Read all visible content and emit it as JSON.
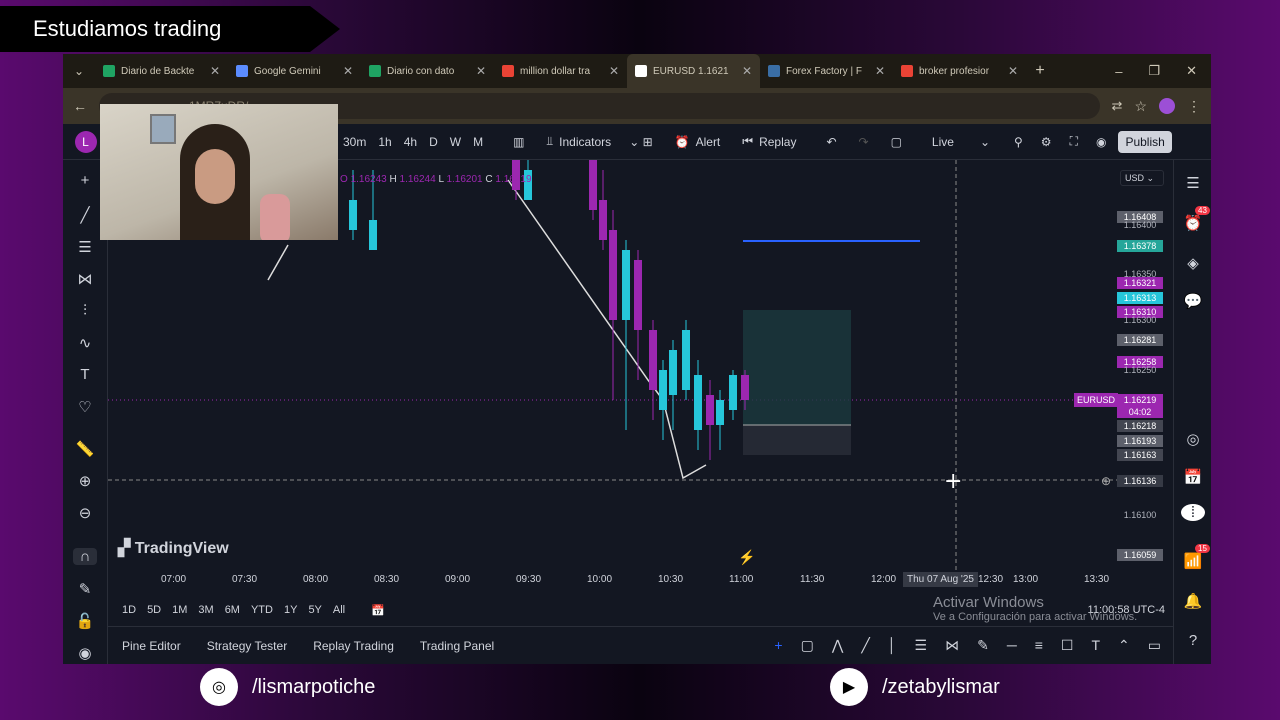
{
  "banner": {
    "title": "Estudiamos trading"
  },
  "tabs": [
    {
      "label": "Diario de Backte",
      "icon": "sheets-icon",
      "color": "#1fa463"
    },
    {
      "label": "Google Gemini",
      "icon": "gemini-icon",
      "color": "#5b8cff"
    },
    {
      "label": "Diario con dato",
      "icon": "sheets-icon",
      "color": "#1fa463"
    },
    {
      "label": "million dollar tra",
      "icon": "google-icon",
      "color": "#ea4335"
    },
    {
      "label": "EURUSD 1.1621",
      "icon": "tradingview-icon",
      "color": "#ffffff"
    },
    {
      "label": "Forex Factory | F",
      "icon": "forexfactory-icon",
      "color": "#3a6ea5"
    },
    {
      "label": "broker profesior",
      "icon": "google-icon",
      "color": "#ea4335"
    }
  ],
  "url": {
    "text": "...1MR7uDR/"
  },
  "toolbar": {
    "timeframes": [
      "30m",
      "1h",
      "4h",
      "D",
      "W",
      "M"
    ],
    "indicators": "Indicators",
    "alert": "Alert",
    "replay": "Replay",
    "live": "Live",
    "publish": "Publish",
    "avatar": "L"
  },
  "legend": {
    "o": "O",
    "ov": "1.16243",
    "h": "H",
    "hv": "1.16244",
    "l": "L",
    "lv": "1.16201",
    "c": "C",
    "cv": "1.16219"
  },
  "price_axis": {
    "currency": "USD",
    "labels": [
      {
        "v": "1.16408",
        "c": "#5d606b"
      },
      {
        "v": "1.16400",
        "c": "none"
      },
      {
        "v": "1.16378",
        "c": "#26a69a"
      },
      {
        "v": "1.16350",
        "c": "none"
      },
      {
        "v": "1.16321",
        "c": "#9c27b0"
      },
      {
        "v": "1.16313",
        "c": "#26c6da"
      },
      {
        "v": "1.16310",
        "c": "#9c27b0"
      },
      {
        "v": "1.16300",
        "c": "none"
      },
      {
        "v": "1.16281",
        "c": "#5d606b"
      },
      {
        "v": "1.16258",
        "c": "#9c27b0"
      },
      {
        "v": "1.16250",
        "c": "none"
      },
      {
        "v": "1.16219",
        "c": "#9c27b0"
      },
      {
        "v": "04:02",
        "c": "#9c27b0"
      },
      {
        "v": "1.16218",
        "c": "#434651"
      },
      {
        "v": "1.16193",
        "c": "#5d606b"
      },
      {
        "v": "1.16163",
        "c": "#434651"
      },
      {
        "v": "1.16136",
        "c": "#363a45"
      },
      {
        "v": "1.16100",
        "c": "none"
      },
      {
        "v": "1.16059",
        "c": "#5d606b"
      }
    ],
    "symbol_label": "EURUSD"
  },
  "time_axis": {
    "labels": [
      "07:00",
      "07:30",
      "08:00",
      "08:30",
      "09:00",
      "09:30",
      "10:00",
      "10:30",
      "11:00",
      "11:30",
      "12:00",
      "12:30",
      "13:00",
      "13:30"
    ],
    "crosshair": "Thu 07 Aug '25"
  },
  "watermark": "TradingView",
  "ranges": [
    "1D",
    "5D",
    "1M",
    "3M",
    "6M",
    "YTD",
    "1Y",
    "5Y",
    "All"
  ],
  "activate": {
    "title": "Activar Windows",
    "sub": "Ve a Configuración para activar Windows."
  },
  "clock": "11:00:58 UTC-4",
  "bottom_tabs": [
    "Pine Editor",
    "Strategy Tester",
    "Replay Trading",
    "Trading Panel"
  ],
  "badges": {
    "alerts": "43",
    "notifications": "15"
  },
  "social": {
    "instagram": "/lismarpotiche",
    "youtube": "/zetabylismar"
  }
}
